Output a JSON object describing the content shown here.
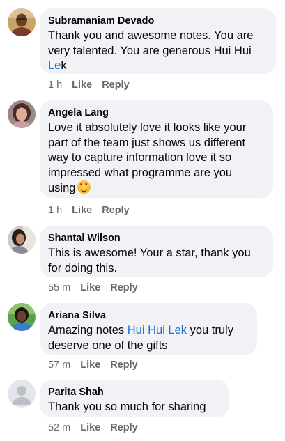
{
  "comments": [
    {
      "name": "Subramaniam Devado",
      "text_lines": [
        "Thank you and awesome notes. You are",
        "very talented. You are generous Hui Hui"
      ],
      "last_plain": "",
      "last_mention": "Le",
      "last_tail": "k",
      "time": "1 h",
      "like": "Like",
      "reply": "Reply",
      "avatar": "man-portrait"
    },
    {
      "name": "Angela Lang",
      "text_lines": [
        "Love it absolutely love it looks like your",
        "part of the team just shows us different",
        "way to capture information love it so",
        "impressed what programme are you"
      ],
      "last_plain": "using",
      "emoji": "heart-eyes-emoji",
      "time": "1 h",
      "like": "Like",
      "reply": "Reply",
      "avatar": "woman-portrait"
    },
    {
      "name": "Shantal Wilson",
      "text_lines": [
        "This is awesome! Your a star, thank you",
        "for doing this."
      ],
      "time": "55 m",
      "like": "Like",
      "reply": "Reply",
      "avatar": "woman-portrait"
    },
    {
      "name": "Ariana Silva",
      "text_pre": "Amazing notes ",
      "mention": "Hui Hui Lek",
      "text_post": " you truly",
      "text_line2": "deserve one of the gifts",
      "time": "57 m",
      "like": "Like",
      "reply": "Reply",
      "avatar": "woman-portrait"
    },
    {
      "name": "Parita Shah",
      "text_lines": [
        "Thank you so much for sharing"
      ],
      "time": "52 m",
      "like": "Like",
      "reply": "Reply",
      "avatar": "default-profile"
    }
  ],
  "colors": {
    "bubble": "#f0f2f5",
    "mention": "#216fdb",
    "meta": "#65676b",
    "text": "#050505"
  }
}
